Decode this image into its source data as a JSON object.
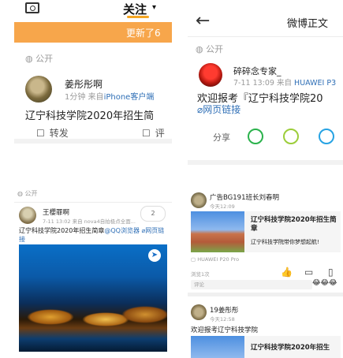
{
  "p1": {
    "follow_tab": "关注",
    "follow_arrow": "▾",
    "update_text": "更新了6",
    "public": "公开",
    "username": "姜彤彤啊",
    "time": "1分钟",
    "source_prefix": "来自",
    "source": "iPhone客户端",
    "content": "辽宁科技学院2020年招生简",
    "repost": "转发",
    "comment": "评"
  },
  "p2": {
    "back": "←",
    "title": "微博正文",
    "public": "公开",
    "username": "碎碎念专家_",
    "time": "7-11 13:09",
    "source_prefix": "来自",
    "source": "HUAWEI P3",
    "content": "欢迎报考『辽宁科技学院20",
    "link": "网页链接",
    "share": "分享"
  },
  "p3": {
    "public": "公开",
    "username": "王櫻罪啊",
    "meta": "7-11 13:02  来自 nova4自拍极点全面...",
    "badge": "2",
    "content_prefix": "辽宁科技学院2020年招生简章",
    "content_link": "@QQ浏览器 ⌀网页链接"
  },
  "p4": {
    "username1": "广告BG191班长刘春明",
    "meta1": "今天12:09",
    "card_title": "辽宁科技学院2020年招生简章",
    "card_sub": "辽宁科技学院带你梦想起航!",
    "device": "HUAWEI P20 Pro",
    "views": "浏览1次",
    "comment_placeholder": "评论",
    "emojis": "😂😂😂",
    "username2": "19姜彤彤",
    "meta2": "今天12:58",
    "content2": "欢迎报考辽宁科技学院",
    "card2_title": "辽宁科技学院2020年招生"
  }
}
